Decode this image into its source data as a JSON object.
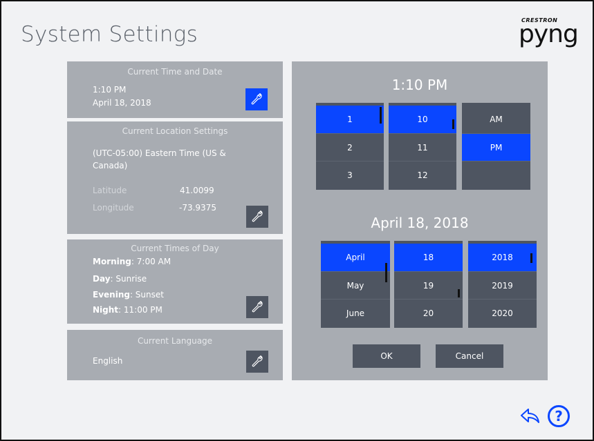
{
  "page": {
    "title": "System Settings"
  },
  "logo": {
    "brand": "CRESTRON",
    "word": "pyng"
  },
  "time_date": {
    "title": "Current Time and Date",
    "time": "1:10 PM",
    "date": "April 18, 2018"
  },
  "location": {
    "title": "Current Location Settings",
    "timezone": "(UTC-05:00) Eastern Time (US & Canada)",
    "latitude_label": "Latitude",
    "latitude_value": "41.0099",
    "longitude_label": "Longitude",
    "longitude_value": "-73.9375"
  },
  "times_of_day": {
    "title": "Current Times of Day",
    "morning_label": "Morning",
    "morning_value": ": 7:00 AM",
    "day_label": "Day",
    "day_value": ": Sunrise",
    "evening_label": "Evening",
    "evening_value": ": Sunset",
    "night_label": "Night",
    "night_value": ": 11:00 PM"
  },
  "language": {
    "title": "Current Language",
    "value": "English"
  },
  "picker": {
    "time_heading": "1:10 PM",
    "hours": [
      "1",
      "2",
      "3"
    ],
    "minutes": [
      "10",
      "11",
      "12"
    ],
    "ampm": [
      "AM",
      "PM",
      ""
    ],
    "date_heading": "April 18, 2018",
    "months": [
      "April",
      "May",
      "June"
    ],
    "days": [
      "18",
      "19",
      "20"
    ],
    "years": [
      "2018",
      "2019",
      "2020"
    ],
    "ok_label": "OK",
    "cancel_label": "Cancel"
  },
  "colors": {
    "accent": "#0a46ff",
    "panel": "#a8acb2",
    "dark": "#4e5561"
  },
  "icons": {
    "edit": "wrench-icon",
    "back": "back-arrow-icon",
    "help": "help-icon"
  }
}
